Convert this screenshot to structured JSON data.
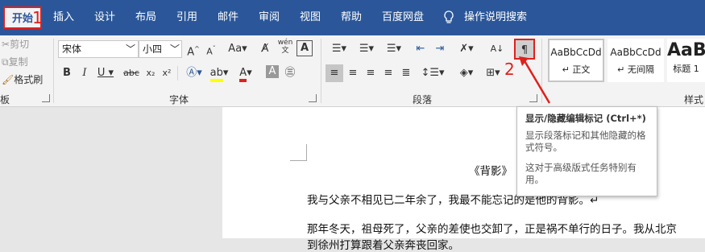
{
  "tabs": [
    "开始",
    "插入",
    "设计",
    "布局",
    "引用",
    "邮件",
    "审阅",
    "视图",
    "帮助",
    "百度网盘"
  ],
  "tell_me": "操作说明搜索",
  "annotations": {
    "first": "1",
    "second": "2"
  },
  "clipboard": {
    "cut": "剪切",
    "copy": "复制",
    "format_painter": "格式刷",
    "label": "板"
  },
  "font": {
    "name": "宋体",
    "size": "小四",
    "label": "字体",
    "aa_case": "Aa",
    "phonetic": "wén",
    "strikethrough": "abc"
  },
  "paragraph": {
    "label": "段落"
  },
  "styles": {
    "label": "样式",
    "cards": [
      {
        "preview": "AaBbCcDd",
        "name": "↵ 正文"
      },
      {
        "preview": "AaBbCcDd",
        "name": "↵ 无间隔"
      },
      {
        "preview": "AaB",
        "name": "标题 1"
      }
    ]
  },
  "tooltip": {
    "title": "显示/隐藏编辑标记 (Ctrl+*)",
    "body": "显示段落标记和其他隐藏的格式符号。",
    "note": "这对于高级版式任务特别有用。"
  },
  "document": {
    "title": "《背影》",
    "p1": "我与父亲不相见已二年余了，我最不能忘记的是他的背影。↵",
    "p2": "那年冬天，祖母死了，父亲的差使也交卸了，正是祸不单行的日子。我从北京",
    "p3": "到徐州打算跟着父亲奔丧回家。"
  },
  "colors": {
    "accent": "#2b579a",
    "annotation": "#e0201c"
  }
}
